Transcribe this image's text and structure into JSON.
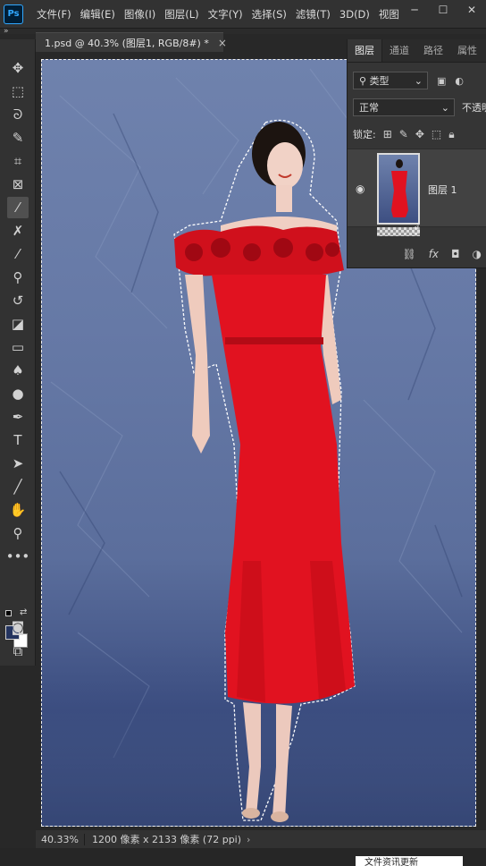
{
  "app": {
    "logo": "Ps"
  },
  "menu": [
    "文件(F)",
    "编辑(E)",
    "图像(I)",
    "图层(L)",
    "文字(Y)",
    "选择(S)",
    "滤镜(T)",
    "3D(D)",
    "视图"
  ],
  "window_controls": {
    "minimize": "─",
    "maximize": "☐",
    "close": "✕"
  },
  "document": {
    "tab_title": "1.psd @ 40.3% (图层1, RGB/8#) *",
    "close": "×"
  },
  "toolbar": {
    "collapse": "»",
    "tools": [
      "move-tool",
      "marquee-tool",
      "lasso-tool",
      "quick-select-tool",
      "crop-tool",
      "frame-tool",
      "eyedropper-tool",
      "healing-brush-tool",
      "brush-tool",
      "clone-stamp-tool",
      "history-brush-tool",
      "eraser-tool",
      "gradient-tool",
      "blur-tool",
      "dodge-tool",
      "pen-tool",
      "type-tool",
      "path-selection-tool",
      "line-tool",
      "hand-tool",
      "zoom-tool",
      "more-tools"
    ],
    "foreground_color": "#24345f",
    "background_color": "#ffffff"
  },
  "layers_panel": {
    "tabs": [
      "图层",
      "通道",
      "路径",
      "属性"
    ],
    "active_tab": "图层",
    "filter_label": "类型",
    "blend_mode": "正常",
    "opacity_label": "不透明度",
    "lock_label": "锁定:",
    "layers": [
      {
        "name": "图层 1",
        "visible": true
      }
    ]
  },
  "status": {
    "zoom": "40.33%",
    "doc_info": "1200 像素 x 2133 像素 (72 ppi)",
    "arrow": "›"
  },
  "notice": {
    "text": "文件资讯更新"
  }
}
